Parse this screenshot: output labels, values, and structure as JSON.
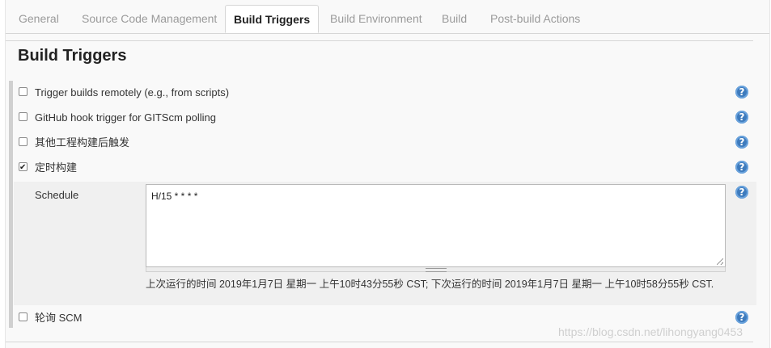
{
  "tabs": [
    {
      "label": "General"
    },
    {
      "label": "Source Code Management"
    },
    {
      "label": "Build Triggers",
      "active": true
    },
    {
      "label": "Build Environment"
    },
    {
      "label": "Build"
    },
    {
      "label": "Post-build Actions"
    }
  ],
  "section": {
    "title": "Build Triggers"
  },
  "triggers": [
    {
      "label": "Trigger builds remotely (e.g., from scripts)",
      "checked": false
    },
    {
      "label": "GitHub hook trigger for GITScm polling",
      "checked": false
    },
    {
      "label": "其他工程构建后触发",
      "checked": false
    },
    {
      "label": "定时构建",
      "checked": true
    },
    {
      "label": "轮询 SCM",
      "checked": false
    }
  ],
  "schedule": {
    "label": "Schedule",
    "value": "H/15 * * * *",
    "info": "上次运行的时间 2019年1月7日 星期一 上午10时43分55秒 CST; 下次运行的时间 2019年1月7日 星期一 上午10时58分55秒 CST."
  },
  "help_icon": {
    "glyph": "?",
    "name": "help-icon"
  },
  "watermark": "https://blog.csdn.net/lihongyang0453",
  "colors": {
    "help": "#3e7bbd",
    "active_tab_text": "#222222",
    "inactive_tab_text": "#9a9a9a"
  }
}
